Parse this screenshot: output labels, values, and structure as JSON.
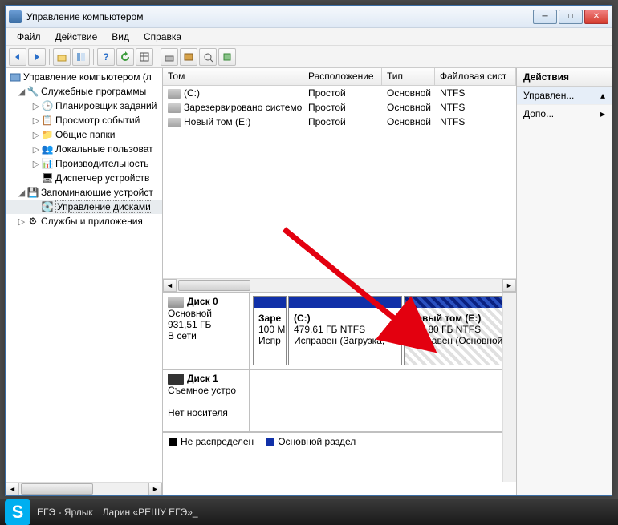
{
  "window": {
    "title": "Управление компьютером"
  },
  "menu": {
    "file": "Файл",
    "action": "Действие",
    "view": "Вид",
    "help": "Справка"
  },
  "tree": {
    "root": "Управление компьютером (л",
    "svc": "Служебные программы",
    "sched": "Планировщик заданий",
    "evt": "Просмотр событий",
    "shared": "Общие папки",
    "users": "Локальные пользоват",
    "perf": "Производительность",
    "devmgr": "Диспетчер устройств",
    "storage": "Запоминающие устройст",
    "diskmgmt": "Управление дисками",
    "services": "Службы и приложения"
  },
  "cols": {
    "vol": "Том",
    "layout": "Расположение",
    "type": "Тип",
    "fs": "Файловая сист"
  },
  "vols": [
    {
      "name": "(C:)",
      "layout": "Простой",
      "type": "Основной",
      "fs": "NTFS"
    },
    {
      "name": "Зарезервировано системой",
      "layout": "Простой",
      "type": "Основной",
      "fs": "NTFS"
    },
    {
      "name": "Новый том (E:)",
      "layout": "Простой",
      "type": "Основной",
      "fs": "NTFS"
    }
  ],
  "disk0": {
    "title": "Диск 0",
    "type": "Основной",
    "size": "931,51 ГБ",
    "status": "В сети",
    "p1": {
      "name": "Заре",
      "size": "100 М",
      "status": "Испр"
    },
    "p2": {
      "name": "(C:)",
      "size": "479,61 ГБ NTFS",
      "status": "Исправен (Загрузка,"
    },
    "p3": {
      "name": "Новый том  (E:)",
      "size": "451,80 ГБ NTFS",
      "status": "Исправен (Основной"
    }
  },
  "disk1": {
    "title": "Диск 1",
    "type": "Съемное устро",
    "status": "Нет носителя"
  },
  "legend": {
    "unalloc": "Не распределен",
    "primary": "Основной раздел"
  },
  "actions": {
    "hdr": "Действия",
    "a1": "Управлен...",
    "a2": "Допо..."
  },
  "taskbar": {
    "larin": "Ларин «РЕШУ ЕГЭ»_",
    "ege": "ЕГЭ - Ярлык"
  }
}
